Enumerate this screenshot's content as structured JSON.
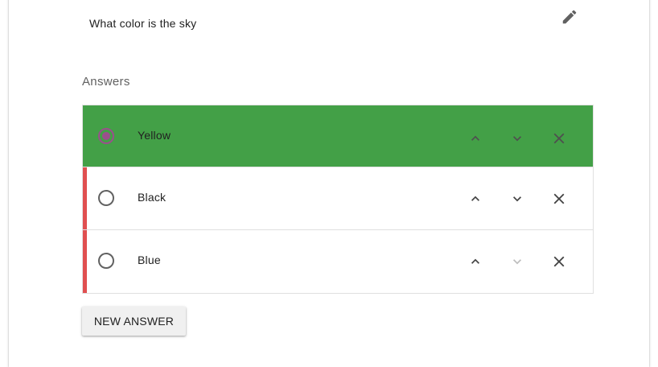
{
  "question": {
    "text": "What color is the sky",
    "edit_icon": "pencil-icon"
  },
  "answers_section": {
    "title": "Answers",
    "items": [
      {
        "label": "Yellow",
        "selected": true,
        "status": "correct",
        "up_enabled": true,
        "down_enabled": true
      },
      {
        "label": "Black",
        "selected": false,
        "status": "wrong",
        "up_enabled": true,
        "down_enabled": true
      },
      {
        "label": "Blue",
        "selected": false,
        "status": "wrong",
        "up_enabled": true,
        "down_enabled": false
      }
    ]
  },
  "actions": {
    "new_answer_label": "NEW ANSWER"
  },
  "colors": {
    "correct_bg": "#43a047",
    "wrong_marker": "#e04f50",
    "radio_selected": "#9b4f8c",
    "icon": "#616161",
    "icon_disabled": "#bdbdbd"
  }
}
